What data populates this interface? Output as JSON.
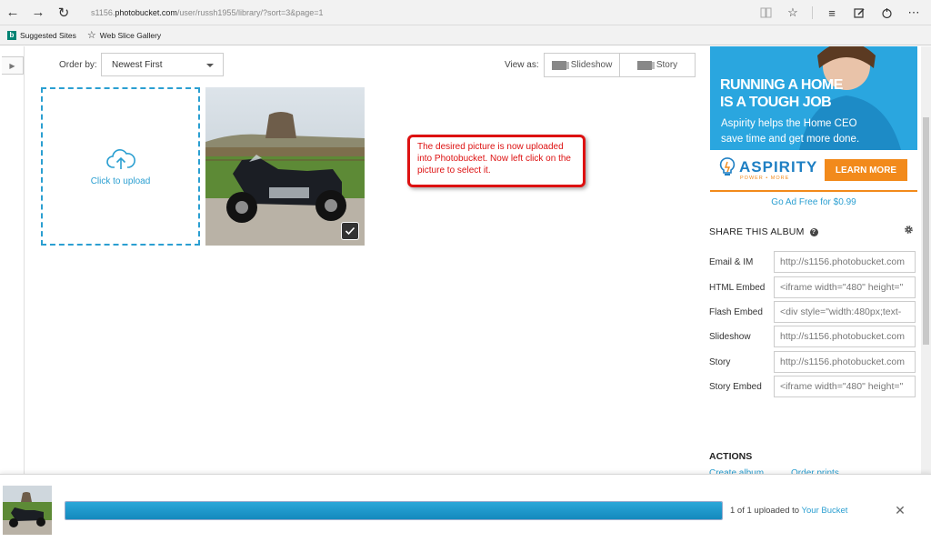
{
  "browser": {
    "url_host": "s1156.photobucket.com",
    "url_prefix": "s1156.",
    "url_domain": "photobucket.com",
    "url_path": "/user/russh1955/library/?sort=3&page=1",
    "favorites": [
      {
        "label": "Suggested Sites",
        "icon": "bing-icon"
      },
      {
        "label": "Web Slice Gallery",
        "icon": "star-icon"
      }
    ]
  },
  "toolbar": {
    "order_label": "Order by:",
    "order_value": "Newest First",
    "view_label": "View as:",
    "view_slideshow": "Slideshow",
    "view_story": "Story"
  },
  "library": {
    "upload_text": "Click to upload"
  },
  "callout": {
    "text": "The desired picture is now uploaded into Photobucket.  Now left click on the picture to select it."
  },
  "ad": {
    "headline_1": "RUNNING A HOME",
    "headline_2": "IS A TOUGH JOB",
    "sub_1": "Aspirity helps the Home CEO",
    "sub_2": "save time and get more done.",
    "brand": "ASPIRITY",
    "brand_tag": "POWER • MORE",
    "cta": "LEARN MORE",
    "go_free": "Go Ad Free for $0.99"
  },
  "share": {
    "title": "SHARE THIS ALBUM",
    "rows": [
      {
        "label": "Email & IM",
        "value": "http://s1156.photobucket.com"
      },
      {
        "label": "HTML Embed",
        "value": "<iframe width=\"480\" height=\""
      },
      {
        "label": "Flash Embed",
        "value": "<div style=\"width:480px;text-"
      },
      {
        "label": "Slideshow",
        "value": "http://s1156.photobucket.com"
      },
      {
        "label": "Story",
        "value": "http://s1156.photobucket.com"
      },
      {
        "label": "Story Embed",
        "value": "<iframe width=\"480\" height=\""
      }
    ]
  },
  "actions": {
    "title": "ACTIONS",
    "create_album": "Create album",
    "order_prints": "Order prints"
  },
  "tray": {
    "progress": 1.0,
    "status_prefix": "1 of 1 uploaded to ",
    "status_link": "Your Bucket"
  },
  "colors": {
    "accent": "#2b9fd1",
    "callout_red": "#dd1111",
    "ad_orange": "#f28a1b"
  }
}
